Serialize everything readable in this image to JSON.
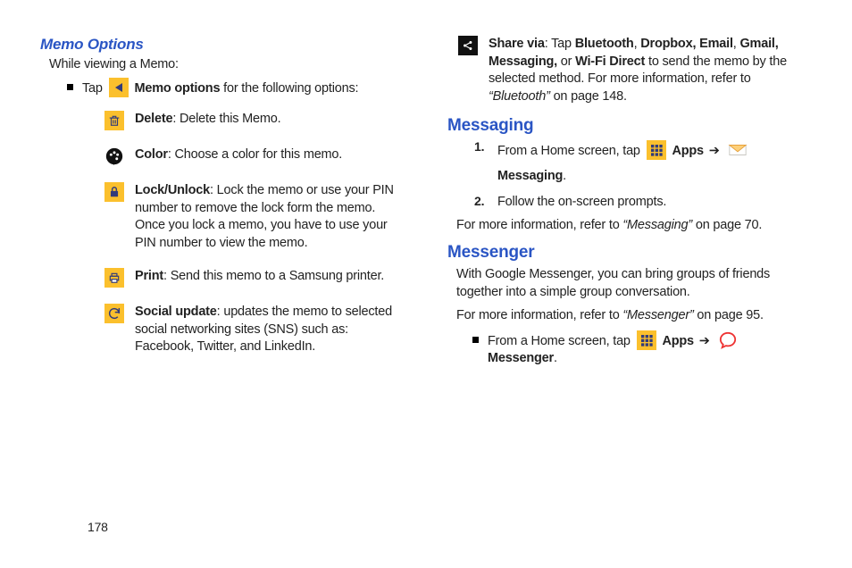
{
  "left": {
    "heading": "Memo Options",
    "intro": "While viewing a Memo:",
    "tap_prefix": "Tap ",
    "memo_options_bold": "Memo options",
    "tap_suffix": " for the following options:",
    "items": {
      "delete": {
        "bold": "Delete",
        "rest": ": Delete this Memo."
      },
      "color": {
        "bold": "Color",
        "rest": ": Choose a color for this memo."
      },
      "lock": {
        "bold": "Lock/Unlock",
        "rest": ": Lock the memo or use your PIN number to remove the lock form the memo. Once you lock a memo, you have to use your PIN number to view the memo."
      },
      "print": {
        "bold": "Print",
        "rest": ": Send this memo to a Samsung printer."
      },
      "social": {
        "bold": "Social update",
        "rest": ": updates the memo to selected social networking sites (SNS) such as: Facebook, Twitter, and LinkedIn."
      }
    }
  },
  "right": {
    "share": {
      "bold": "Share via",
      "p1": ": Tap ",
      "b2": "Bluetooth",
      "c1": ", ",
      "b3": "Dropbox, Email",
      "c2": ", ",
      "b4": "Gmail, Messaging,",
      "mid": " or ",
      "b5": "Wi-Fi Direct",
      "rest": " to send the memo by the selected method. For more information, refer to ",
      "ref": "“Bluetooth” ",
      "page": " on page 148."
    },
    "messaging": {
      "heading": "Messaging",
      "step1_a": "From a Home screen, tap ",
      "apps": "Apps",
      "arrow": "➔",
      "messaging": "Messaging",
      "step1_dot": ".",
      "step2": "Follow the on-screen prompts.",
      "refer_a": "For more information, refer to ",
      "refer_i": "“Messaging” ",
      "refer_b": " on page 70."
    },
    "messenger": {
      "heading": "Messenger",
      "p1": "With Google Messenger, you can bring groups of friends together into a simple group conversation.",
      "refer_a": "For more information, refer to ",
      "refer_i": "“Messenger” ",
      "refer_b": " on page 95.",
      "tap_a": "From a Home screen, tap ",
      "apps": "Apps",
      "arrow": "➔",
      "label": "Messenger",
      "dot": "."
    }
  },
  "page_number": "178",
  "num": {
    "one": "1.",
    "two": "2."
  }
}
